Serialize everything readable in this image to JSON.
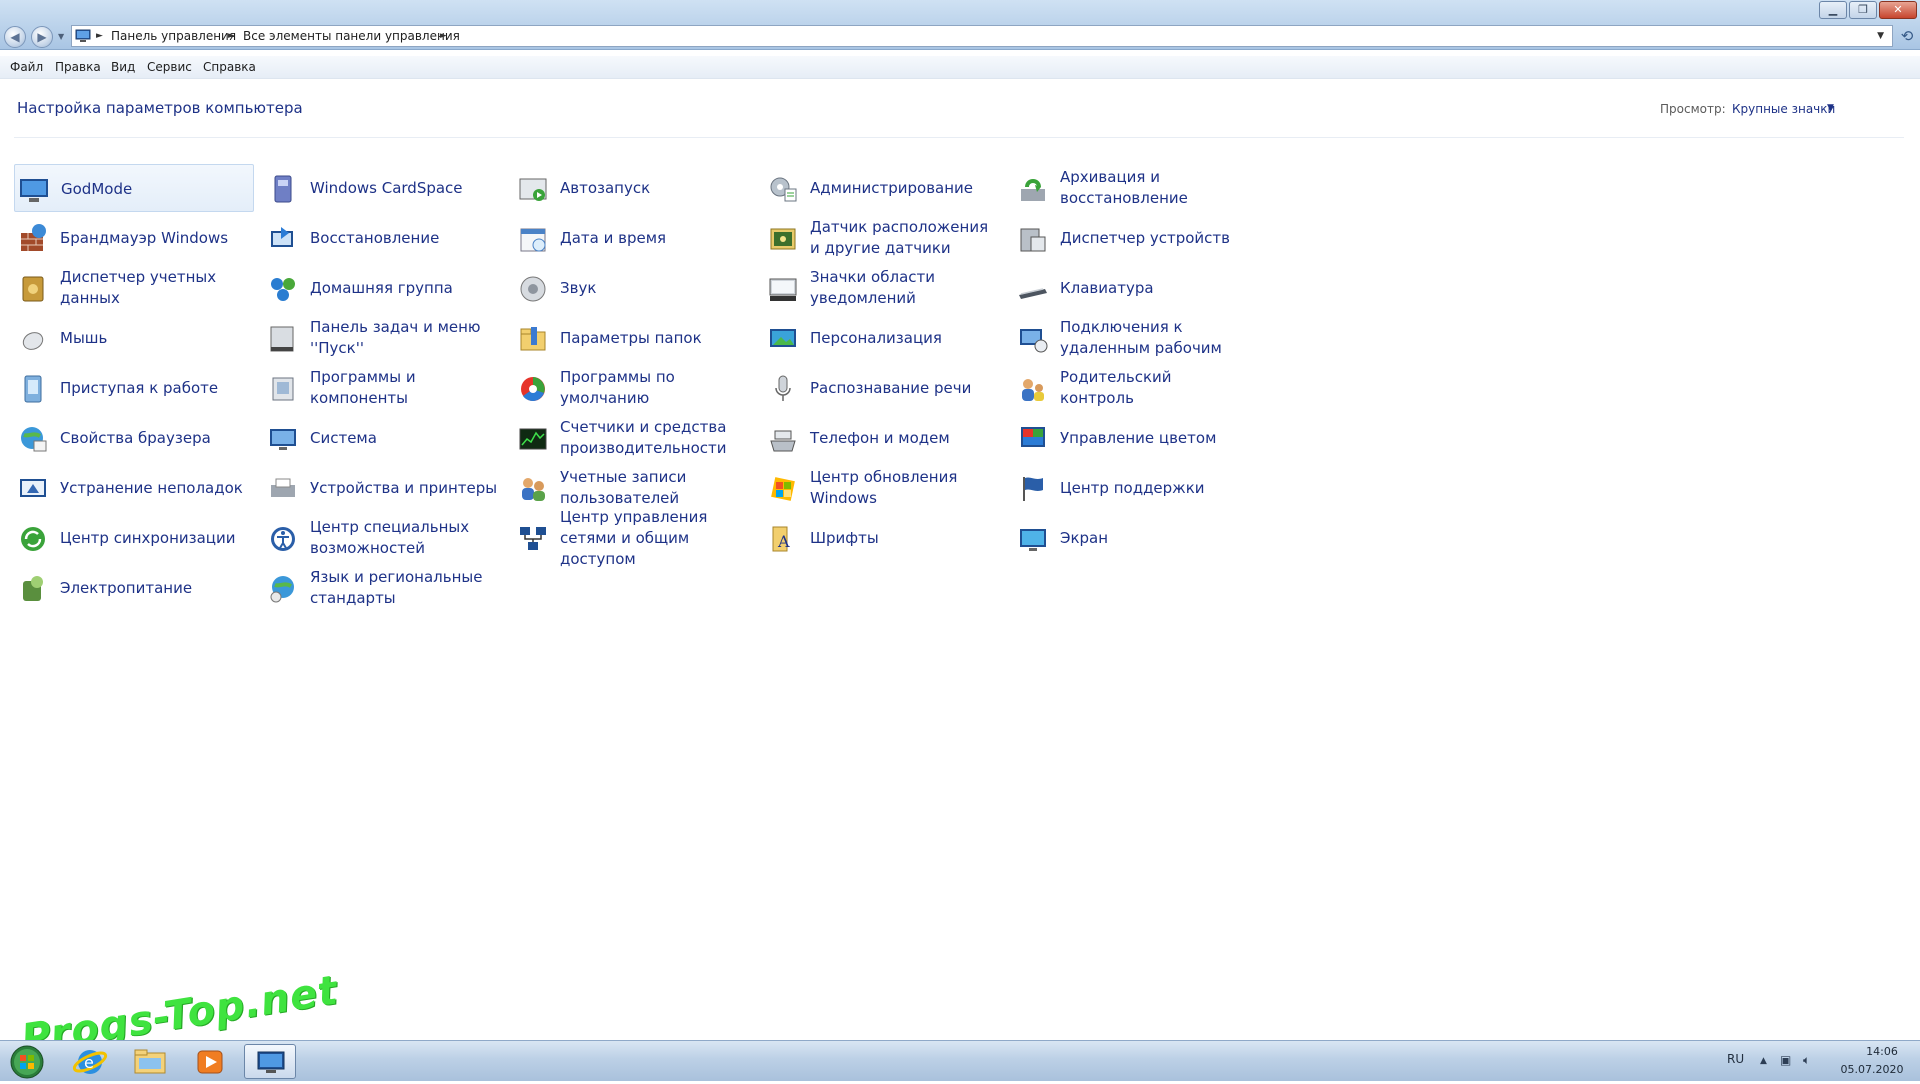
{
  "address": {
    "crumbs": [
      "Панель управления",
      "Все элементы панели управления"
    ]
  },
  "menu": [
    "Файл",
    "Правка",
    "Вид",
    "Сервис",
    "Справка"
  ],
  "heading": "Настройка параметров компьютера",
  "view": {
    "label": "Просмотр:",
    "value": "Крупные значки"
  },
  "items": [
    {
      "label": "GodMode",
      "icon": "monitor-icon"
    },
    {
      "label": "Брандмауэр Windows",
      "icon": "firewall-icon"
    },
    {
      "label": "Диспетчер учетных данных",
      "icon": "credential-vault-icon"
    },
    {
      "label": "Мышь",
      "icon": "mouse-icon"
    },
    {
      "label": "Приступая к работе",
      "icon": "getting-started-icon"
    },
    {
      "label": "Свойства браузера",
      "icon": "internet-options-icon"
    },
    {
      "label": "Устранение неполадок",
      "icon": "troubleshooting-icon"
    },
    {
      "label": "Центр синхронизации",
      "icon": "sync-center-icon"
    },
    {
      "label": "Электропитание",
      "icon": "power-options-icon"
    },
    {
      "label": "Windows CardSpace",
      "icon": "cardspace-icon"
    },
    {
      "label": "Восстановление",
      "icon": "recovery-icon"
    },
    {
      "label": "Домашняя группа",
      "icon": "homegroup-icon"
    },
    {
      "label": "Панель задач и меню ''Пуск''",
      "icon": "taskbar-start-icon"
    },
    {
      "label": "Программы и компоненты",
      "icon": "programs-features-icon"
    },
    {
      "label": "Система",
      "icon": "system-icon"
    },
    {
      "label": "Устройства и принтеры",
      "icon": "devices-printers-icon"
    },
    {
      "label": "Центр специальных возможностей",
      "icon": "ease-of-access-icon"
    },
    {
      "label": "Язык и региональные стандарты",
      "icon": "region-language-icon"
    },
    {
      "label": "Автозапуск",
      "icon": "autoplay-icon"
    },
    {
      "label": "Дата и время",
      "icon": "date-time-icon"
    },
    {
      "label": "Звук",
      "icon": "sound-icon"
    },
    {
      "label": "Параметры папок",
      "icon": "folder-options-icon"
    },
    {
      "label": "Программы по умолчанию",
      "icon": "default-programs-icon"
    },
    {
      "label": "Счетчики и средства производительности",
      "icon": "performance-icon"
    },
    {
      "label": "Учетные записи пользователей",
      "icon": "user-accounts-icon"
    },
    {
      "label": "Центр управления сетями и общим доступом",
      "icon": "network-sharing-icon"
    },
    {
      "label": "Администрирование",
      "icon": "admin-tools-icon"
    },
    {
      "label": "Датчик расположения и другие датчики",
      "icon": "location-sensors-icon"
    },
    {
      "label": "Значки области уведомлений",
      "icon": "notification-icons-icon"
    },
    {
      "label": "Персонализация",
      "icon": "personalization-icon"
    },
    {
      "label": "Распознавание речи",
      "icon": "speech-recognition-icon"
    },
    {
      "label": "Телефон и модем",
      "icon": "phone-modem-icon"
    },
    {
      "label": "Центр обновления Windows",
      "icon": "windows-update-icon"
    },
    {
      "label": "Шрифты",
      "icon": "fonts-icon"
    },
    {
      "label": "Архивация и восстановление",
      "icon": "backup-restore-icon"
    },
    {
      "label": "Диспетчер устройств",
      "icon": "device-manager-icon"
    },
    {
      "label": "Клавиатура",
      "icon": "keyboard-icon"
    },
    {
      "label": "Подключения к удаленным рабочим",
      "icon": "remote-desktop-icon"
    },
    {
      "label": "Родительский контроль",
      "icon": "parental-controls-icon"
    },
    {
      "label": "Управление цветом",
      "icon": "color-management-icon"
    },
    {
      "label": "Центр поддержки",
      "icon": "action-center-icon"
    },
    {
      "label": "Экран",
      "icon": "display-icon"
    }
  ],
  "taskbar": {
    "apps": [
      "start-orb-icon",
      "internet-explorer-icon",
      "explorer-icon",
      "media-player-icon",
      "control-panel-icon"
    ],
    "language": "RU",
    "time": "14:06",
    "date": "05.07.2020"
  },
  "watermark": "Progs-Top.net",
  "colors": {
    "link": "#1e3287",
    "selection": "#e4eef9",
    "taskbar": "#bcd0e6"
  }
}
